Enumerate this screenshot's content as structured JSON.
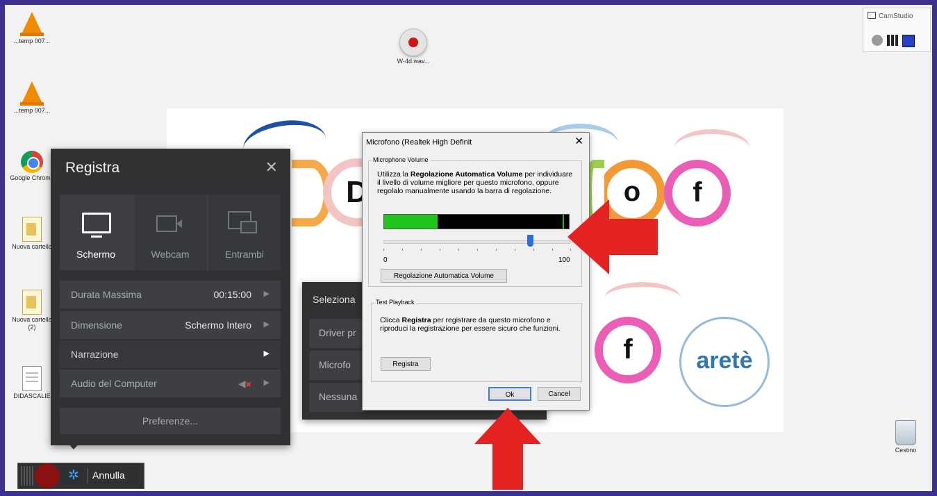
{
  "desktop": {
    "icons": [
      {
        "label": "...temp 007...",
        "icon": "vlc-cone-icon"
      },
      {
        "label": "...temp 007...",
        "icon": "vlc-cone-icon"
      },
      {
        "label": "Google Chrome",
        "icon": "chrome-icon"
      },
      {
        "label": "Nuova cartella",
        "icon": "folder-icon"
      },
      {
        "label": "Nuova cartella (2)",
        "icon": "folder-icon"
      },
      {
        "label": "DIDASCALIE",
        "icon": "document-icon"
      },
      {
        "label": "W-4d.wav...",
        "icon": "record-icon"
      },
      {
        "label": "Cestino",
        "icon": "recycle-bin-icon"
      }
    ]
  },
  "camstudio": {
    "title": "CamStudio"
  },
  "slide": {
    "letters": [
      "D",
      "o",
      "f",
      "f"
    ],
    "logo": "aretè"
  },
  "recorder": {
    "title": "Registra",
    "modes": [
      "Schermo",
      "Webcam",
      "Entrambi"
    ],
    "rows": [
      {
        "key": "Durata Massima",
        "value": "00:15:00"
      },
      {
        "key": "Dimensione",
        "value": "Schermo Intero"
      },
      {
        "key": "Narrazione",
        "value": ""
      },
      {
        "key": "Audio del Computer",
        "value": ""
      }
    ],
    "preferences": "Preferenze...",
    "cancel": "Annulla"
  },
  "submenu": {
    "header": "Seleziona",
    "items": [
      "Driver pr",
      "Microfo",
      "Nessuna"
    ]
  },
  "dialog": {
    "title": "Microfono (Realtek High Definit",
    "close": "✕",
    "volume_group": "Microphone Volume",
    "volume_text_1": "Utilizza la ",
    "volume_text_bold": "Regolazione Automatica Volume",
    "volume_text_2": " per individuare il livello di volume migliore per questo microfono, oppure regolalo manualmente usando la barra di regolazione.",
    "slider_min": "0",
    "slider_max": "100",
    "slider_level": 0.78,
    "meter_level": 0.29,
    "auto_button": "Regolazione Automatica Volume",
    "playback_group": "Test Playback",
    "playback_text_1": "Clicca ",
    "playback_text_bold": "Registra",
    "playback_text_2": " per registrare da questo microfono e riproduci la registrazione per essere sicuro che funzioni.",
    "record_button": "Registra",
    "ok_button": "Ok",
    "cancel_button": "Cancel"
  },
  "colors": {
    "accent": "#e52222",
    "panel": "#2f3133",
    "frame": "#3b2f8f"
  }
}
